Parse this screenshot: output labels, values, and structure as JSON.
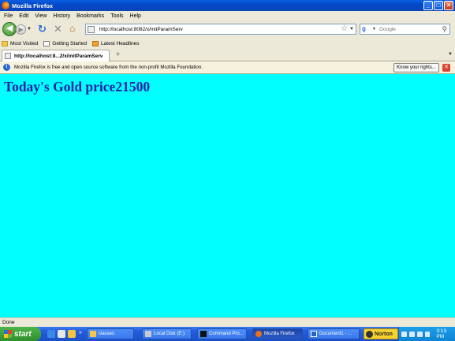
{
  "window": {
    "title": "Mozilla Firefox",
    "buttons": {
      "minimize": "_",
      "maximize": "□",
      "close": "✕"
    }
  },
  "menubar": [
    "File",
    "Edit",
    "View",
    "History",
    "Bookmarks",
    "Tools",
    "Help"
  ],
  "navigation": {
    "url": "http://localhost:8082/x/initParamServ",
    "search_placeholder": "Google",
    "search_engine_icon": "google-icon"
  },
  "bookmarks": [
    {
      "label": "Most Visited",
      "icon": "folder-icon"
    },
    {
      "label": "Getting Started",
      "icon": "page-icon"
    },
    {
      "label": "Latest Headlines",
      "icon": "live-feed-icon"
    }
  ],
  "tabs": [
    {
      "label": "http://localhost:8...2/x/initParamServ",
      "active": true
    }
  ],
  "infobar": {
    "message": "Mozilla Firefox is free and open source software from the non-profit Mozilla Foundation.",
    "button_label": "Know your rights..."
  },
  "page": {
    "heading": "Today's Gold price21500",
    "background_color": "#00ffff",
    "heading_color": "#2222a8"
  },
  "status": {
    "text": "Done"
  },
  "taskbar": {
    "start_label": "start",
    "tasks": [
      {
        "label": "classes",
        "icon": "folder-icon"
      },
      {
        "label": "Local Disk (E:)",
        "icon": "drive-icon"
      },
      {
        "label": "Command Pro...",
        "icon": "cmd-icon"
      },
      {
        "label": "Mozilla Firefox",
        "icon": "firefox-icon",
        "active": true
      },
      {
        "label": "Document1 - ...",
        "icon": "word-icon"
      }
    ],
    "norton_label": "Norton",
    "clock": "3:13 PM"
  }
}
